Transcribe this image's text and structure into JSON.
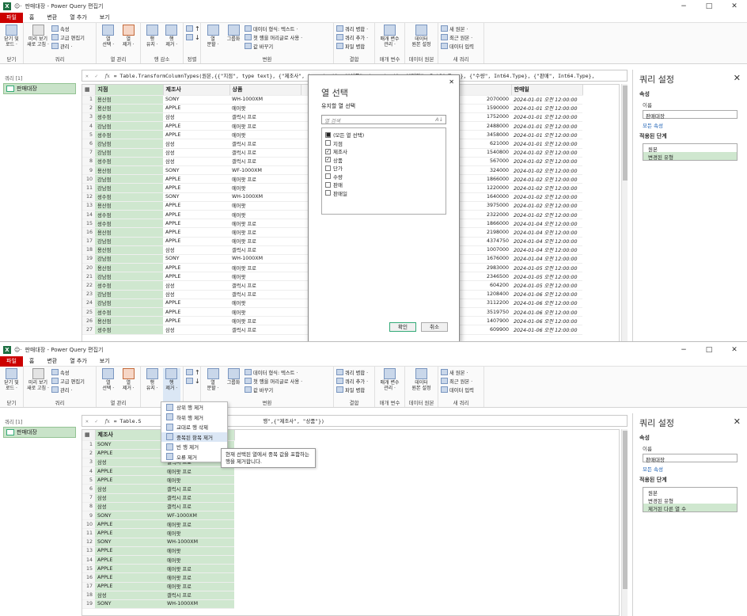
{
  "w1": {
    "title": "판매대장 - Power Query 편집기",
    "tabs": [
      "파일",
      "홈",
      "변환",
      "열 추가",
      "보기"
    ],
    "ribbon": {
      "close": {
        "b1": "닫기 및",
        "b2": "로드 ·",
        "label": "닫기"
      },
      "query": {
        "b1": "미리 보기",
        "b2": "새로 고침 ·",
        "s": [
          "속성",
          "고급 편집기",
          "관리 ·"
        ],
        "label": "쿼리"
      },
      "cols": {
        "b1": "열",
        "b1b": "선택 ·",
        "b2": "열",
        "b2b": "제거 ·",
        "label": "열 관리"
      },
      "rows": {
        "b1": "행",
        "b1b": "유지 ·",
        "b2": "행",
        "b2b": "제거 ·",
        "label": "행 감소"
      },
      "sort": {
        "label": "정렬"
      },
      "transform": {
        "b1": "열",
        "b1b": "분할 ·",
        "b2": "그룹화",
        "s": [
          "데이터 형식: 텍스트 ·",
          "첫 행을 머리글로 사용 ·",
          "값 바꾸기"
        ],
        "label": "변환"
      },
      "combine": {
        "s": [
          "쿼리 병합 ·",
          "쿼리 추가 ·",
          "파일 병합"
        ],
        "label": "결합"
      },
      "params": {
        "b1": "매개 변수",
        "b2": "관리 ·",
        "label": "매개 변수"
      },
      "source": {
        "b1": "데이터",
        "b2": "원본 설정",
        "label": "데이터 원본"
      },
      "newq": {
        "s": [
          "새 원본 ·",
          "최근 원본 ·",
          "데이터 입력"
        ],
        "label": "새 쿼리"
      }
    },
    "nav": {
      "head": "쿼리 [1]",
      "item": "판매대장"
    },
    "formula": "= Table.TransformColumnTypes(원본,{{\"지점\", type text}, {\"제조사\", type text}, {\"상품\", type text}, {\"단가\", Int64.Type}, {\"수량\", Int64.Type}, {\"판매\", Int64.Type},",
    "headers": [
      "지점",
      "제조사",
      "상품",
      "판매일"
    ],
    "rows": [
      [
        "1",
        "용산점",
        "SONY",
        "WH-1000XM",
        "2070000",
        "2024-01-01 오전 12:00:00"
      ],
      [
        "2",
        "용산점",
        "APPLE",
        "에어팟",
        "1590000",
        "2024-01-01 오전 12:00:00"
      ],
      [
        "3",
        "성수점",
        "삼성",
        "갤럭시 프로",
        "1752000",
        "2024-01-01 오전 12:00:00"
      ],
      [
        "4",
        "강남점",
        "APPLE",
        "에어팟 프로",
        "2488000",
        "2024-01-01 오전 12:00:00"
      ],
      [
        "5",
        "성수점",
        "APPLE",
        "에어팟",
        "3458000",
        "2024-01-01 오전 12:00:00"
      ],
      [
        "6",
        "강남점",
        "삼성",
        "갤럭시 프로",
        "621000",
        "2024-01-01 오전 12:00:00"
      ],
      [
        "7",
        "강남점",
        "삼성",
        "갤럭시 프로",
        "1540800",
        "2024-01-02 오전 12:00:00"
      ],
      [
        "8",
        "성수점",
        "삼성",
        "갤럭시 프로",
        "567000",
        "2024-01-02 오전 12:00:00"
      ],
      [
        "9",
        "용산점",
        "SONY",
        "WF-1000XM",
        "324000",
        "2024-01-02 오전 12:00:00"
      ],
      [
        "10",
        "강남점",
        "APPLE",
        "에어팟 프로",
        "1866000",
        "2024-01-02 오전 12:00:00"
      ],
      [
        "11",
        "강남점",
        "APPLE",
        "에어팟",
        "1220000",
        "2024-01-02 오전 12:00:00"
      ],
      [
        "12",
        "성수점",
        "SONY",
        "WH-1000XM",
        "1640000",
        "2024-01-02 오전 12:00:00"
      ],
      [
        "13",
        "용산점",
        "APPLE",
        "에어팟",
        "3975000",
        "2024-01-02 오전 12:00:00"
      ],
      [
        "14",
        "성수점",
        "APPLE",
        "에어팟",
        "2322000",
        "2024-01-02 오전 12:00:00"
      ],
      [
        "15",
        "성수점",
        "APPLE",
        "에어팟 프로",
        "1866000",
        "2024-01-04 오전 12:00:00"
      ],
      [
        "16",
        "용산점",
        "APPLE",
        "에어팟 프로",
        "2198000",
        "2024-01-04 오전 12:00:00"
      ],
      [
        "17",
        "강남점",
        "APPLE",
        "에어팟 프로",
        "4374750",
        "2024-01-04 오전 12:00:00"
      ],
      [
        "18",
        "용산점",
        "삼성",
        "갤럭시 프로",
        "1007000",
        "2024-01-04 오전 12:00:00"
      ],
      [
        "19",
        "강남점",
        "SONY",
        "WH-1000XM",
        "1676000",
        "2024-01-04 오전 12:00:00"
      ],
      [
        "20",
        "용산점",
        "APPLE",
        "에어팟 프로",
        "2983000",
        "2024-01-05 오전 12:00:00"
      ],
      [
        "21",
        "강남점",
        "APPLE",
        "에어팟",
        "2346500",
        "2024-01-05 오전 12:00:00"
      ],
      [
        "22",
        "성수점",
        "삼성",
        "갤럭시 프로",
        "604200",
        "2024-01-05 오전 12:00:00"
      ],
      [
        "23",
        "강남점",
        "삼성",
        "갤럭시 프로",
        "1208400",
        "2024-01-06 오전 12:00:00"
      ],
      [
        "24",
        "강남점",
        "APPLE",
        "에어팟",
        "3112200",
        "2024-01-06 오전 12:00:00"
      ],
      [
        "25",
        "성수점",
        "APPLE",
        "에어팟",
        "3519750",
        "2024-01-06 오전 12:00:00"
      ],
      [
        "26",
        "용산점",
        "APPLE",
        "에어팟 프로",
        "1407900",
        "2024-01-06 오전 12:00:00"
      ],
      [
        "27",
        "성수점",
        "삼성",
        "갤럭시 프로",
        "609900",
        "2024-01-06 오전 12:00:00"
      ]
    ],
    "settings": {
      "title": "쿼리 설정",
      "props": "속성",
      "name_label": "이름",
      "name": "판매대장",
      "all_props": "모든 속성",
      "steps_label": "적용된 단계",
      "steps": [
        "원본",
        "변경된 유형"
      ]
    },
    "dialog": {
      "title": "열 선택",
      "subtitle": "유지할 열 선택",
      "search": "열 검색",
      "items": [
        {
          "label": "(모든 열 선택)",
          "state": "■"
        },
        {
          "label": "지점",
          "state": ""
        },
        {
          "label": "제조사",
          "state": "✓"
        },
        {
          "label": "상품",
          "state": "✓"
        },
        {
          "label": "단가",
          "state": ""
        },
        {
          "label": "수량",
          "state": ""
        },
        {
          "label": "판매",
          "state": ""
        },
        {
          "label": "판매일",
          "state": ""
        }
      ],
      "ok": "확인",
      "cancel": "취소"
    }
  },
  "w2": {
    "title": "판매대장 - Power Query 편집기",
    "formula": "= Table.S                                        행\",{\"제조사\", \"상품\"})",
    "headers": [
      "제조사"
    ],
    "rows": [
      [
        "1",
        "SONY",
        "WH-1000XM"
      ],
      [
        "2",
        "APPLE",
        "에어팟"
      ],
      [
        "3",
        "삼성",
        "갤럭시 프로"
      ],
      [
        "4",
        "APPLE",
        "에어팟 프로"
      ],
      [
        "5",
        "APPLE",
        "에어팟"
      ],
      [
        "6",
        "삼성",
        "갤럭시 프로"
      ],
      [
        "7",
        "삼성",
        "갤럭시 프로"
      ],
      [
        "8",
        "삼성",
        "갤럭시 프로"
      ],
      [
        "9",
        "SONY",
        "WF-1000XM"
      ],
      [
        "10",
        "APPLE",
        "에어팟 프로"
      ],
      [
        "11",
        "APPLE",
        "에어팟"
      ],
      [
        "12",
        "SONY",
        "WH-1000XM"
      ],
      [
        "13",
        "APPLE",
        "에어팟"
      ],
      [
        "14",
        "APPLE",
        "에어팟"
      ],
      [
        "15",
        "APPLE",
        "에어팟 프로"
      ],
      [
        "16",
        "APPLE",
        "에어팟 프로"
      ],
      [
        "17",
        "APPLE",
        "에어팟 프로"
      ],
      [
        "18",
        "삼성",
        "갤럭시 프로"
      ],
      [
        "19",
        "SONY",
        "WH-1000XM"
      ]
    ],
    "menu": [
      "상위 행 제거",
      "하위 행 제거",
      "교대로 행 삭제",
      "중복된 항목 제거",
      "빈 행 제거",
      "오류 제거"
    ],
    "tooltip": "현재 선택된 열에서 중복 값을 포함하는 행을 제거합니다.",
    "steps": [
      "원본",
      "변경된 유형",
      "제거된 다른 열 수"
    ]
  }
}
